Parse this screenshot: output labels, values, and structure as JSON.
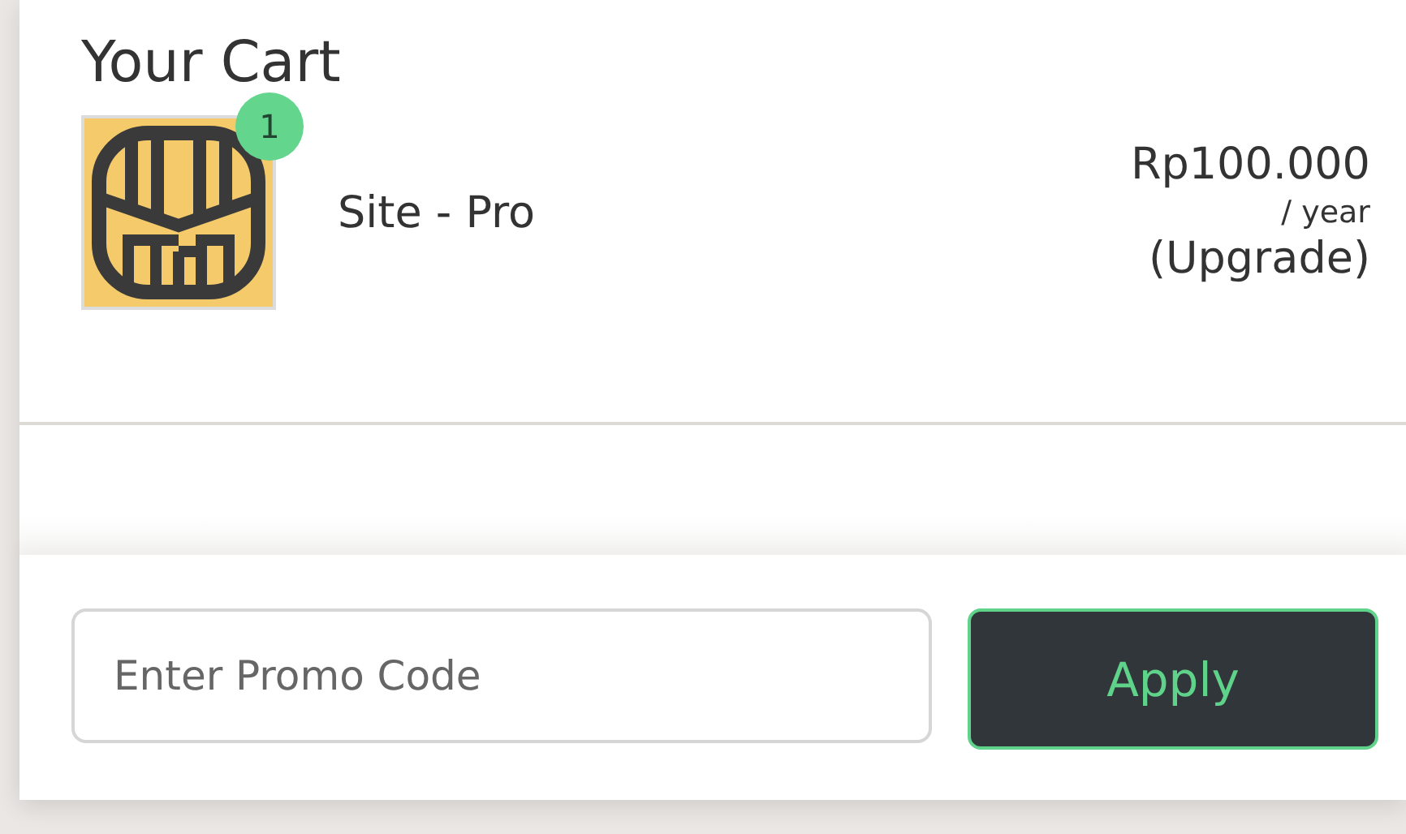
{
  "cart": {
    "title": "Your Cart",
    "items": [
      {
        "quantity": "1",
        "name": "Site - Pro",
        "price": "Rp100.000",
        "period": "/ year",
        "note": "(Upgrade)"
      }
    ]
  },
  "promo": {
    "placeholder": "Enter Promo Code",
    "button": "Apply"
  }
}
